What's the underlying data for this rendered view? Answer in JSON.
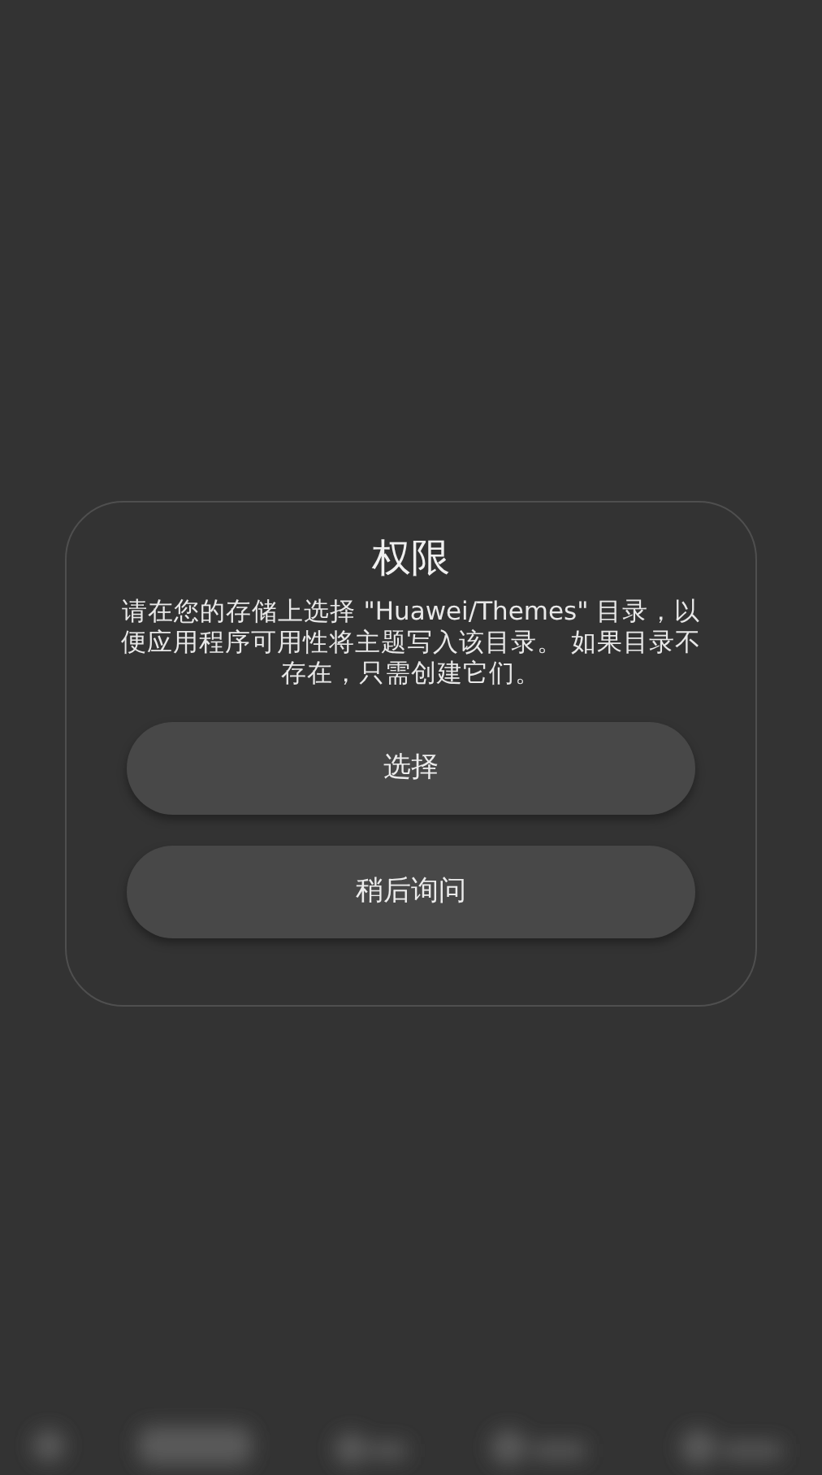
{
  "dialog": {
    "title": "权限",
    "message": "请在您的存储上选择 \"Huawei/Themes\" 目录，以便应用程序可用性将主题写入该目录。 如果目录不存在，只需创建它们。",
    "buttons": [
      "选择",
      "稍后询问"
    ]
  }
}
